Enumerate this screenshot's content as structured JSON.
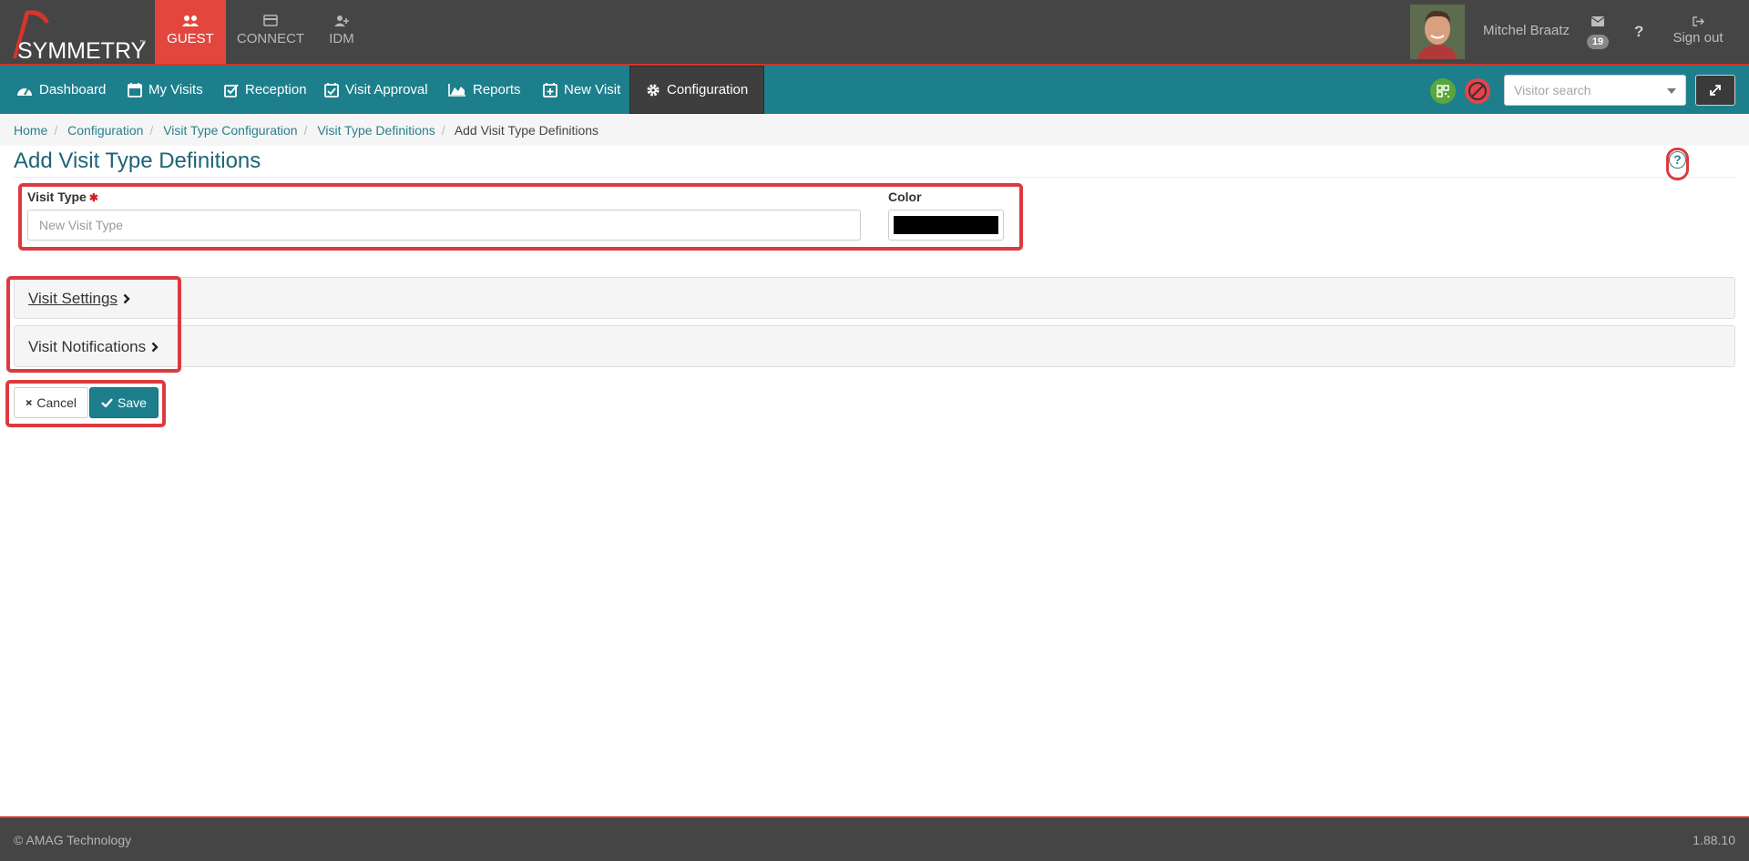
{
  "brand": {
    "name": "SYMMETRY",
    "tm": "™"
  },
  "app_tabs": [
    {
      "label": "GUEST",
      "icon": "users-icon"
    },
    {
      "label": "CONNECT",
      "icon": "card-icon"
    },
    {
      "label": "IDM",
      "icon": "user-plus-icon"
    }
  ],
  "user": {
    "name": "Mitchel Braatz",
    "mail_count": "19",
    "help": "?",
    "signout": "Sign out"
  },
  "nav": {
    "items": [
      "Dashboard",
      "My Visits",
      "Reception",
      "Visit Approval",
      "Reports",
      "New Visit",
      "Configuration"
    ],
    "active": "Configuration",
    "visitor_search_placeholder": "Visitor search"
  },
  "breadcrumb": {
    "links": [
      "Home",
      "Configuration",
      "Visit Type Configuration",
      "Visit Type Definitions"
    ],
    "current": "Add Visit Type Definitions"
  },
  "page": {
    "title": "Add Visit Type Definitions",
    "help": "?",
    "visit_type_label": "Visit Type",
    "required_mark": "✱",
    "visit_type_placeholder": "New Visit Type",
    "visit_type_value": "",
    "color_label": "Color",
    "color_value": "#000000"
  },
  "panels": [
    "Visit Settings",
    "Visit Notifications"
  ],
  "buttons": {
    "cancel": "Cancel",
    "save": "Save"
  },
  "footer": {
    "copyright": "© AMAG Technology",
    "version": "1.88.10"
  },
  "colors": {
    "accent": "#1d7f8c",
    "brand_red": "#e3463d",
    "highlight": "#dd3a40"
  }
}
